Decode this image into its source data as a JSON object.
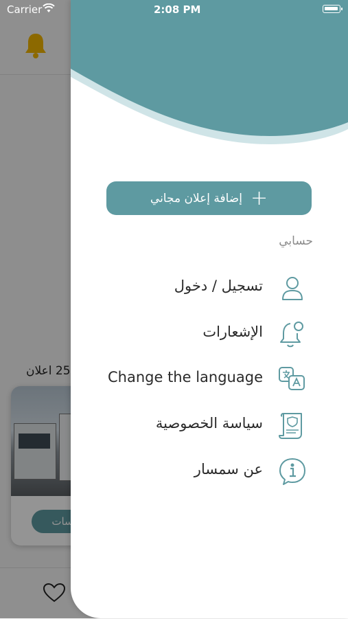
{
  "status_bar": {
    "carrier": "Carrier",
    "time": "2:08 PM"
  },
  "background": {
    "ads_count": "25 اعلان",
    "ad_button": "سات"
  },
  "drawer": {
    "add_ad_button": "إضافة إعلان مجاني",
    "section_label": "حسابي",
    "items": [
      {
        "label": "تسجيل / دخول",
        "icon": "user-icon"
      },
      {
        "label": "الإشعارات",
        "icon": "bell-icon"
      },
      {
        "label": "Change the language",
        "icon": "language-icon"
      },
      {
        "label": "سياسة الخصوصية",
        "icon": "document-shield-icon"
      },
      {
        "label": "عن سمسار",
        "icon": "info-icon"
      }
    ]
  },
  "colors": {
    "accent": "#5e9aa1",
    "accent_light": "#cfe4e7",
    "icon_stroke": "#5e9aa1",
    "bell_yellow": "#f1b600"
  }
}
